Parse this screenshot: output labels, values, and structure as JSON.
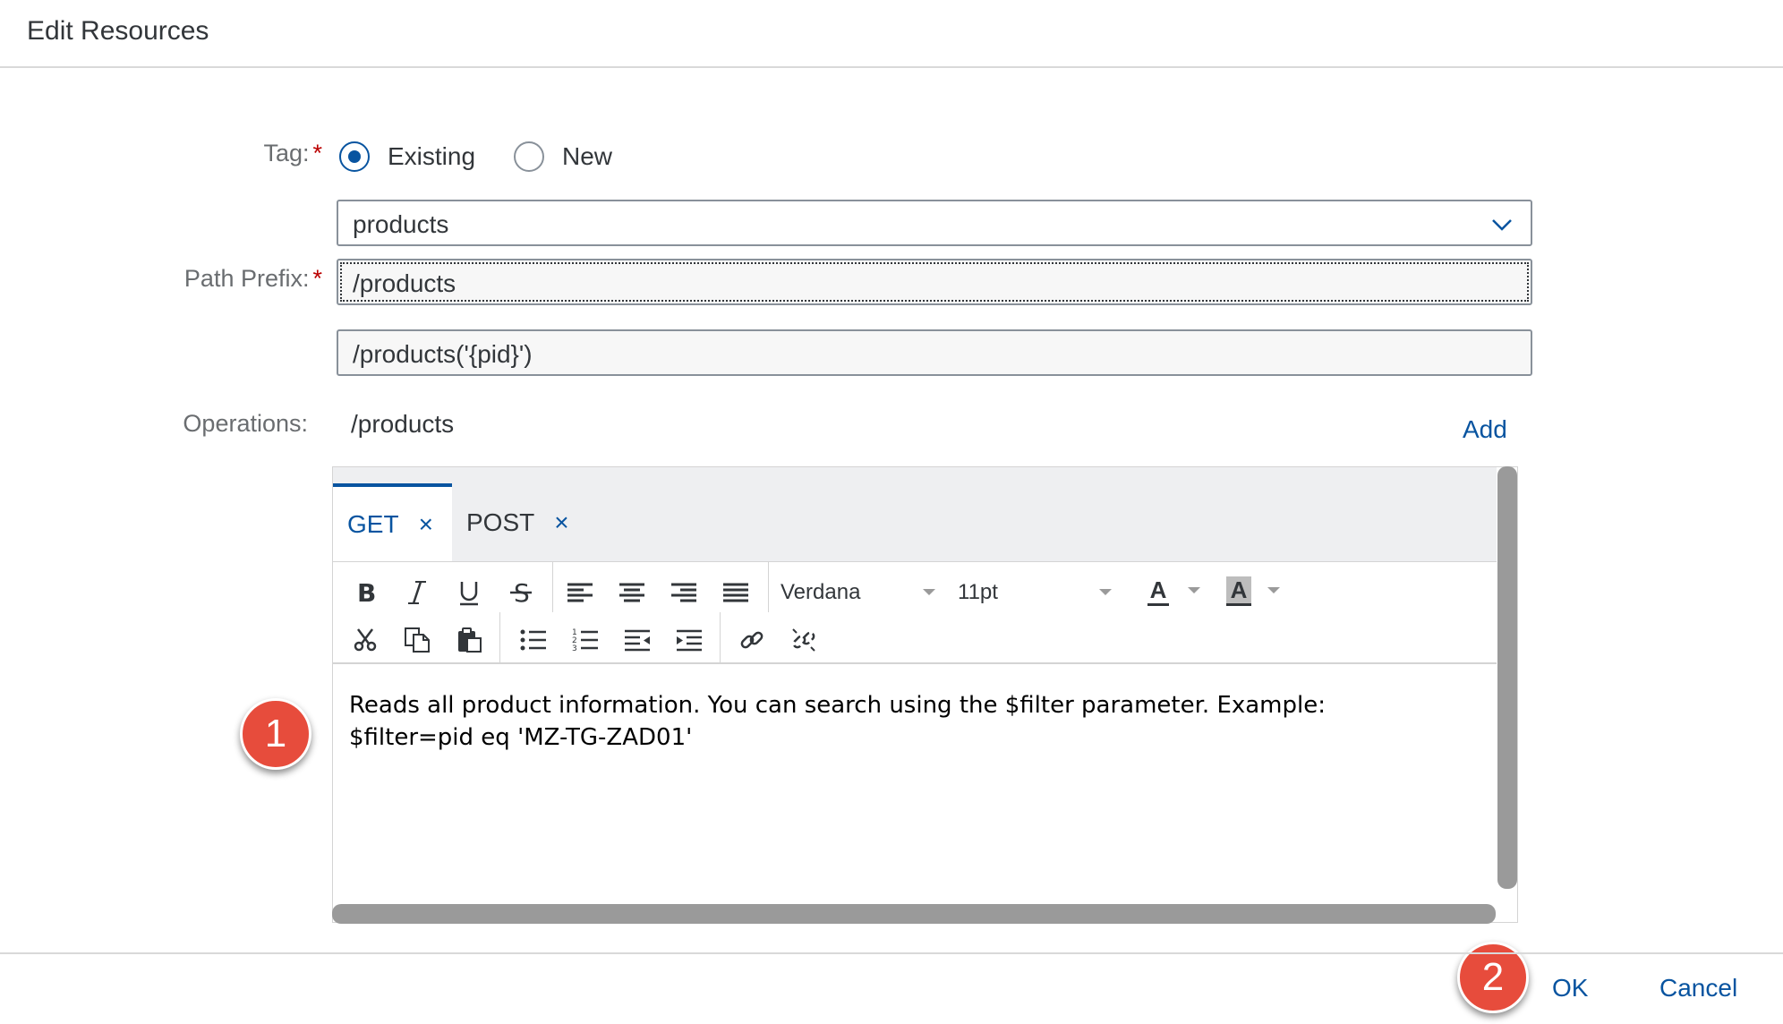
{
  "dialog": {
    "title": "Edit Resources"
  },
  "form": {
    "tag_label": "Tag:",
    "required_mark": "*",
    "radio_existing": "Existing",
    "radio_new": "New",
    "tag_selected": "existing",
    "tag_value": "products",
    "path_prefix_label": "Path Prefix:",
    "path_prefix_value": "/products",
    "path_secondary_value": "/products('{pid}')",
    "operations_label": "Operations:",
    "operations_path": "/products",
    "add_label": "Add"
  },
  "editor": {
    "tabs": [
      {
        "label": "GET",
        "active": true
      },
      {
        "label": "POST",
        "active": false
      }
    ],
    "close_glyph": "×",
    "font_family_value": "Verdana",
    "font_size_value": "11pt",
    "text_color_glyph": "A",
    "bg_color_glyph": "A",
    "content_line1": "Reads all product information. You can search using the $filter parameter. Example:",
    "content_line2": "$filter=pid eq 'MZ-TG-ZAD01'"
  },
  "callouts": {
    "first": "1",
    "second": "2"
  },
  "footer": {
    "ok_label": "OK",
    "cancel_label": "Cancel"
  },
  "colors": {
    "accent": "#0854a0",
    "required": "#bb0000",
    "callout": "#e74c3c"
  }
}
